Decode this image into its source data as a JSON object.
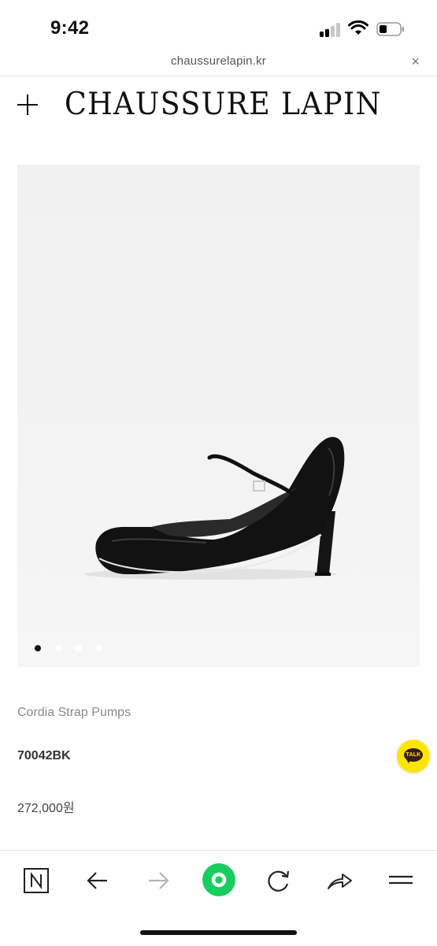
{
  "status_bar": {
    "time": "9:42",
    "icons": [
      "signal-icon",
      "wifi-icon",
      "battery-icon"
    ]
  },
  "browser": {
    "url": "chaussurelapin.kr",
    "close_icon": "×"
  },
  "header": {
    "menu_icon": "+",
    "brand": "CHAUSSURE LAPIN"
  },
  "product": {
    "image_alt": "black leather mary jane strap pump",
    "carousel": {
      "count": 4,
      "active_index": 0
    },
    "name": "Cordia Strap Pumps",
    "code": "70042BK",
    "price": "272,000원"
  },
  "chat": {
    "label": "TALK",
    "accent": "#FEE500"
  },
  "toolbar": {
    "items": [
      "naver-home-icon",
      "back-icon",
      "forward-icon",
      "green-dot-icon",
      "reload-icon",
      "share-icon",
      "menu-icon"
    ],
    "green": "#19CE60"
  }
}
